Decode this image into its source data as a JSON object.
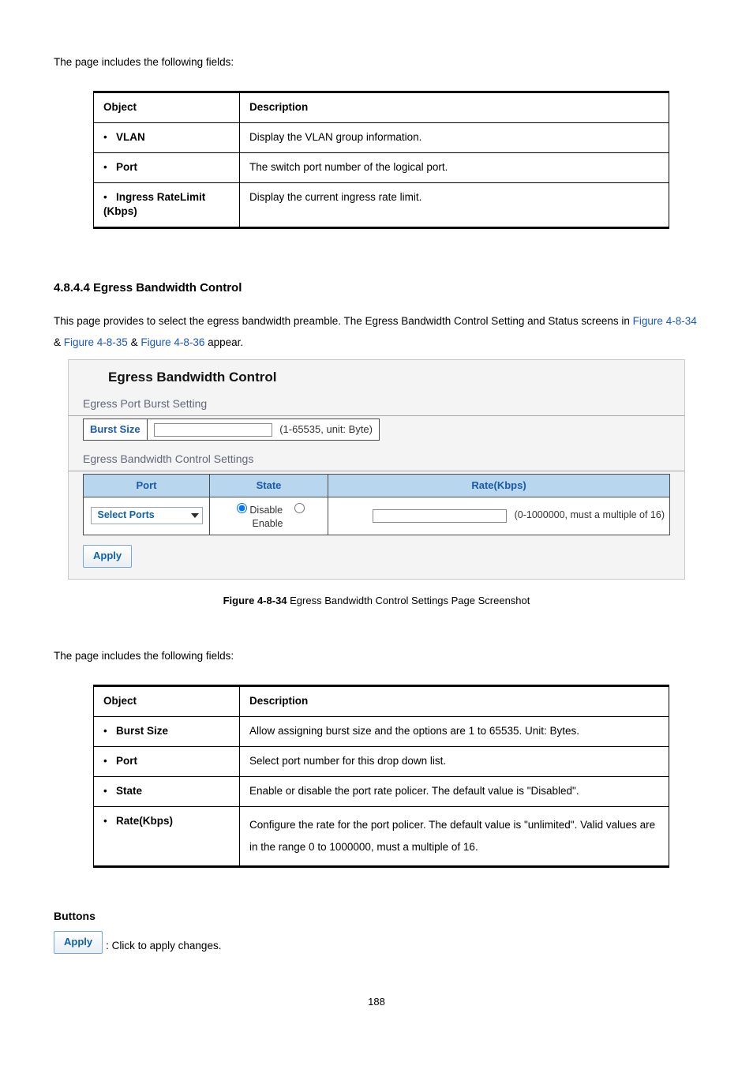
{
  "intro1_lead": "The page includes the following fields:",
  "table1": {
    "head_obj": "Object",
    "head_desc": "Description",
    "rows": [
      {
        "obj": "VLAN",
        "desc": "Display the VLAN group information."
      },
      {
        "obj": "Port",
        "desc": "The switch port number of the logical port."
      },
      {
        "obj": "Ingress RateLimit (Kbps)",
        "desc": "Display the current ingress rate limit."
      }
    ]
  },
  "section": {
    "num": "4.8.4.4",
    "title": "Egress Bandwidth Control",
    "lead1": "This page provides to select the egress bandwidth preamble. The Egress Bandwidth Control Setting and Status screens in ",
    "link1": "Figure 4-8-34",
    "amp": " & ",
    "link2": "Figure 4-8-35",
    "link3": "Figure 4-8-36",
    "tail": " appear."
  },
  "panel": {
    "title": "Egress Bandwidth Control",
    "burst_heading": "Egress Port Burst Setting",
    "burst_label": "Burst Size",
    "burst_hint": "(1-65535, unit: Byte)",
    "ctl_heading": "Egress Bandwidth Control Settings",
    "ctl_head_port": "Port",
    "ctl_head_state": "State",
    "ctl_head_rate": "Rate(Kbps)",
    "dropdown_label": "Select Ports",
    "state_disable": "Disable",
    "state_enable": "Enable",
    "rate_hint": "(0-1000000, must a multiple of 16)",
    "apply_label": "Apply",
    "caption_pre": "Figure 4-8-34 ",
    "caption_txt": "Egress Bandwidth Control Settings Page Screenshot"
  },
  "intro2_lead": "The page includes the following fields:",
  "table2": {
    "head_obj": "Object",
    "head_desc": "Description",
    "rows": [
      {
        "obj": "Burst Size",
        "desc": "Allow assigning burst size and the options are 1 to 65535. Unit: Bytes."
      },
      {
        "obj": "Port",
        "desc": "Select port number for this drop down list."
      },
      {
        "obj": "State",
        "desc": "Enable or disable the port rate policer. The default value is \"Disabled\"."
      },
      {
        "obj": "Rate(Kbps)",
        "desc": "Configure the rate for the port policer. The default value is \"unlimited\". Valid values are in the range 0 to 1000000, must a multiple of 16."
      }
    ]
  },
  "buttons": {
    "heading": "Buttons",
    "apply_label": "Apply",
    "apply_desc": ": Click to apply changes."
  },
  "page_number": "188"
}
